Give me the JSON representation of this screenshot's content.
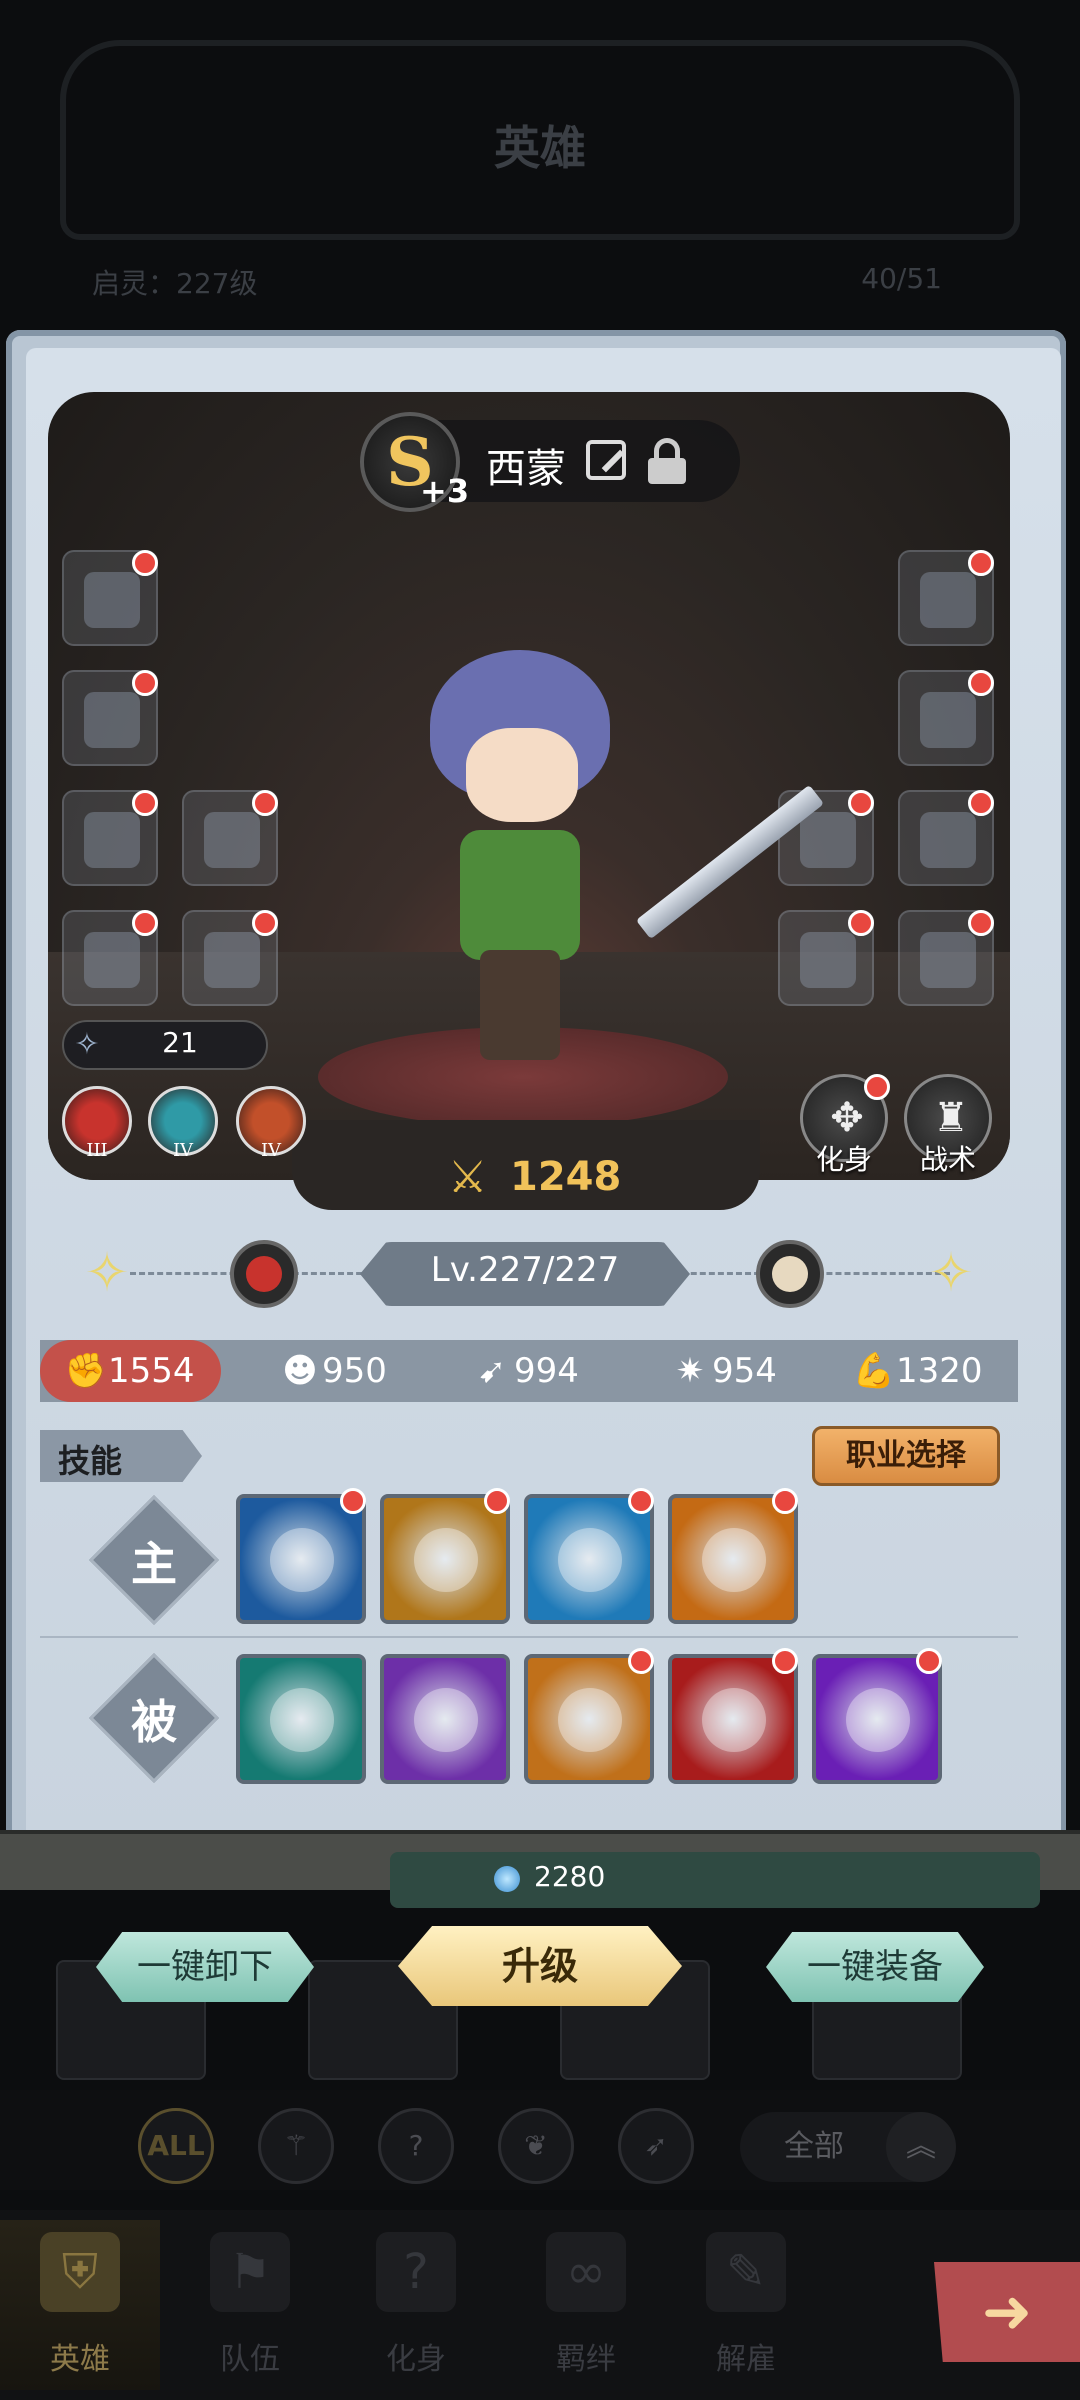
{
  "header": {
    "title": "英雄",
    "spirit_level": "启灵：227级",
    "hero_count": "40/51"
  },
  "hero": {
    "rank": "S",
    "rank_plus": "+3",
    "name": "西蒙",
    "hp_value": "21",
    "power": "1248",
    "runes": [
      {
        "level": "III",
        "color": "#c8332d"
      },
      {
        "level": "IV",
        "color": "#2f9aa6"
      },
      {
        "level": "IV",
        "color": "#c2502a"
      }
    ],
    "actions": {
      "avatar": "化身",
      "tactics": "战术"
    }
  },
  "level": {
    "text": "Lv.227/227"
  },
  "stats": [
    {
      "icon": "fist-icon",
      "value": "1554"
    },
    {
      "icon": "head-icon",
      "value": "950"
    },
    {
      "icon": "dash-icon",
      "value": "994"
    },
    {
      "icon": "burst-icon",
      "value": "954"
    },
    {
      "icon": "arm-icon",
      "value": "1320"
    }
  ],
  "skills": {
    "tag": "技能",
    "job_button": "职业选择",
    "active_label": "主",
    "passive_label": "被",
    "active": [
      {
        "name": "vortex-icon",
        "bg": "#1d5a9e"
      },
      {
        "name": "meditate-icon",
        "bg": "#b0761a"
      },
      {
        "name": "slash-icon",
        "bg": "#1f7ab8"
      },
      {
        "name": "flame-wave-icon",
        "bg": "#c46a14"
      }
    ],
    "passive": [
      {
        "name": "runner-icon",
        "bg": "#157a72"
      },
      {
        "name": "dark-armor-icon",
        "bg": "#6d2fa8"
      },
      {
        "name": "cross-swords-icon",
        "bg": "#c0701a"
      },
      {
        "name": "blood-spear-icon",
        "bg": "#a81c1c"
      },
      {
        "name": "arcane-orb-icon",
        "bg": "#6a1fb5"
      }
    ]
  },
  "currency": {
    "value": "2280"
  },
  "actions": {
    "unequip_all": "一键卸下",
    "upgrade": "升级",
    "equip_all": "一键装备"
  },
  "filters": {
    "all": "ALL",
    "all_types": "全部"
  },
  "tabs": [
    {
      "label": "英雄",
      "icon": "helmet-icon"
    },
    {
      "label": "队伍",
      "icon": "flag-icon"
    },
    {
      "label": "化身",
      "icon": "mask-icon"
    },
    {
      "label": "羁绊",
      "icon": "bond-icon"
    },
    {
      "label": "解雇",
      "icon": "dismiss-icon"
    }
  ]
}
